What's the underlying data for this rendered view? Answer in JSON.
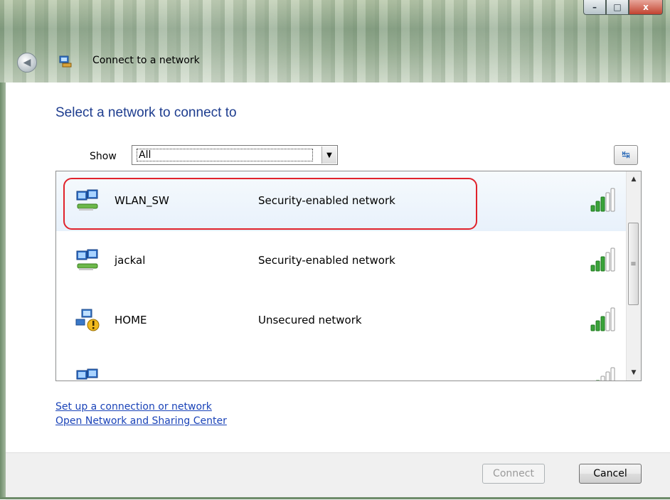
{
  "window": {
    "title": "Connect to a network",
    "controls": {
      "minimize": "–",
      "maximize": "□",
      "close": "x"
    }
  },
  "main": {
    "heading": "Select a network to connect to",
    "show_label": "Show",
    "show_value": "All",
    "networks": [
      {
        "name": "WLAN_SW",
        "security": "Security-enabled network",
        "icon": "secured-network-icon",
        "signal_bars": 5,
        "selected": true
      },
      {
        "name": "jackal",
        "security": "Security-enabled network",
        "icon": "secured-network-icon",
        "signal_bars": 5,
        "selected": false
      },
      {
        "name": "HOME",
        "security": "Unsecured network",
        "icon": "unsecured-network-icon",
        "signal_bars": 5,
        "selected": false
      },
      {
        "name": "",
        "security": "",
        "icon": "secured-network-icon",
        "signal_bars": 2,
        "selected": false
      }
    ]
  },
  "links": {
    "setup": "Set up a connection or network",
    "sharing_center": "Open Network and Sharing Center"
  },
  "buttons": {
    "connect": "Connect",
    "cancel": "Cancel"
  },
  "colors": {
    "heading": "#1e3d8f",
    "link": "#1a43b8",
    "highlight": "#e0222b",
    "signal": "#3aa33a"
  }
}
